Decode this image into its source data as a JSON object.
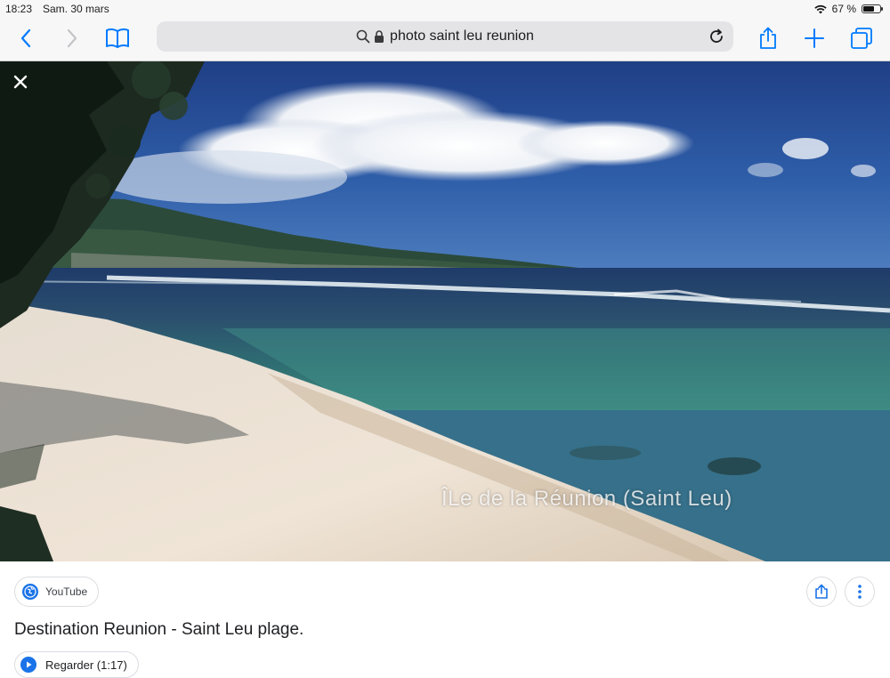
{
  "status_bar": {
    "time": "18:23",
    "date": "Sam. 30 mars",
    "battery": "67 %",
    "battery_level": 0.67
  },
  "toolbar": {
    "url_text": "photo saint leu reunion",
    "icons": [
      "back-icon",
      "forward-icon",
      "bookmarks-icon",
      "search-icon",
      "lock-icon",
      "reload-icon",
      "share-icon",
      "new-tab-icon",
      "tabs-icon"
    ],
    "accent_color": "#007aff"
  },
  "viewer": {
    "watermark": "ÎLe de la Réunion (Saint Leu)"
  },
  "result": {
    "source": "YouTube",
    "title": "Destination Reunion - Saint Leu plage.",
    "watch_label": "Regarder (1:17)",
    "accent_color": "#1a73e8"
  }
}
